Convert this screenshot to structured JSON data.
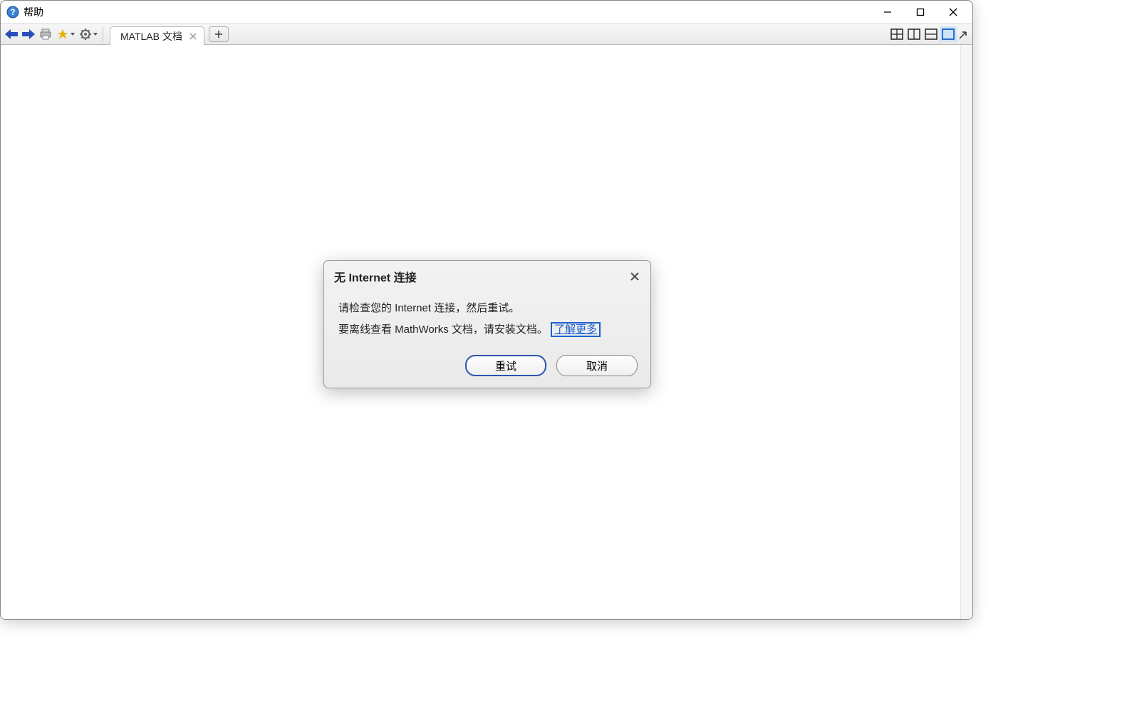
{
  "window": {
    "title": "帮助"
  },
  "toolbar": {
    "icons": {
      "back": "back-arrow-icon",
      "forward": "forward-arrow-icon",
      "print": "print-icon",
      "favorites": "star-icon",
      "settings": "gear-icon"
    }
  },
  "tabs": {
    "items": [
      {
        "label": "MATLAB 文档"
      }
    ],
    "add_tooltip": "+"
  },
  "layout": {
    "options": [
      "grid",
      "columns",
      "rows",
      "single"
    ],
    "active_index": 3
  },
  "dialog": {
    "title": "无 Internet 连接",
    "body_line1": "请检查您的 Internet 连接，然后重试。",
    "body_line2_prefix": "要离线查看 MathWorks 文档，请安装文档。",
    "learn_more": "了解更多",
    "retry_label": "重试",
    "cancel_label": "取消"
  }
}
